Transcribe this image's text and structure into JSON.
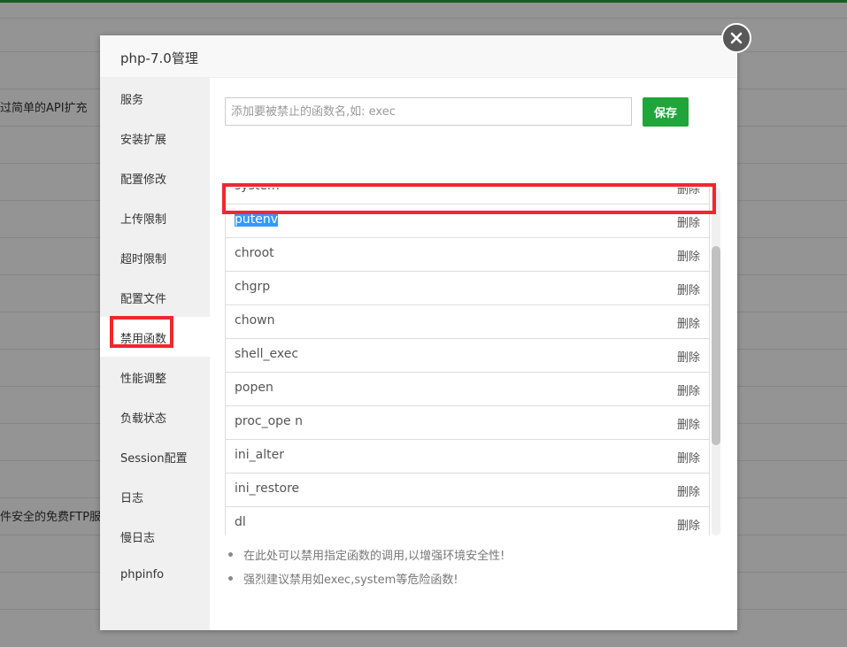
{
  "background": {
    "text_1": "过简单的API扩充",
    "text_2": "件安全的免费FTP服"
  },
  "modal": {
    "title": "php-7.0管理",
    "close_icon": "close-icon"
  },
  "sidebar": {
    "items": [
      {
        "label": "服务"
      },
      {
        "label": "安装扩展"
      },
      {
        "label": "配置修改"
      },
      {
        "label": "上传限制"
      },
      {
        "label": "超时限制"
      },
      {
        "label": "配置文件"
      },
      {
        "label": "禁用函数",
        "active": true
      },
      {
        "label": "性能调整"
      },
      {
        "label": "负载状态"
      },
      {
        "label": "Session配置"
      },
      {
        "label": "日志"
      },
      {
        "label": "慢日志"
      },
      {
        "label": "phpinfo"
      }
    ]
  },
  "form": {
    "placeholder": "添加要被禁止的函数名,如: exec",
    "value": "",
    "save_label": "保存"
  },
  "functions": {
    "delete_label": "删除",
    "scroll_offset_rows": 0.5,
    "items": [
      {
        "name": "system"
      },
      {
        "name": "putenv",
        "selected": true
      },
      {
        "name": "chroot"
      },
      {
        "name": "chgrp"
      },
      {
        "name": "chown"
      },
      {
        "name": "shell_exec"
      },
      {
        "name": "popen"
      },
      {
        "name": "proc_ope n"
      },
      {
        "name": "ini_alter"
      },
      {
        "name": "ini_restore"
      },
      {
        "name": "dl"
      }
    ]
  },
  "tips": [
    "在此处可以禁用指定函数的调用,以增强环境安全性!",
    "强烈建议禁用如exec,system等危险函数!"
  ],
  "colors": {
    "accent": "#20a53a",
    "highlight_border": "#f2262f",
    "selection": "#3399ff"
  }
}
